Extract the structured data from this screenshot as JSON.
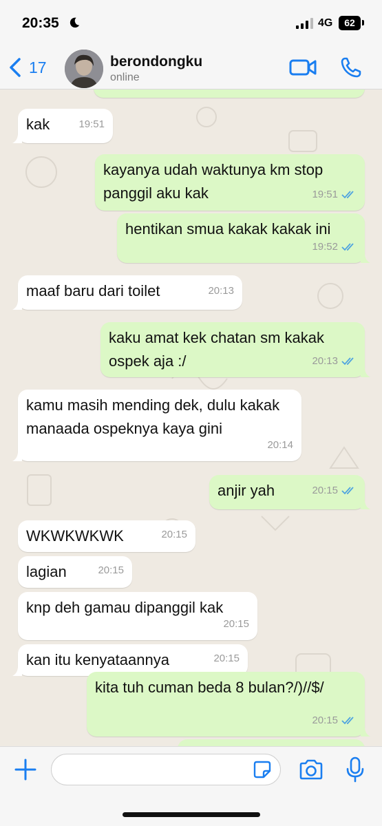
{
  "status_bar": {
    "time": "20:35",
    "network": "4G",
    "battery": "62"
  },
  "header": {
    "back_count": "17",
    "contact_name": "berondongku",
    "contact_status": "online"
  },
  "messages": [
    {
      "direction": "in",
      "text": "kak",
      "time": "19:51"
    },
    {
      "direction": "out",
      "text": "kayanya udah waktunya km stop panggil aku kak",
      "time": "19:51"
    },
    {
      "direction": "out",
      "text": "hentikan smua kakak kakak ini",
      "time": "19:52"
    },
    {
      "direction": "in",
      "text": "maaf baru dari toilet",
      "time": "20:13"
    },
    {
      "direction": "out",
      "text": "kaku amat kek chatan sm kakak ospek aja :/",
      "time": "20:13"
    },
    {
      "direction": "in",
      "text": "kamu masih mending dek, dulu kakak manaada ospeknya kaya gini",
      "time": "20:14"
    },
    {
      "direction": "out",
      "text": "anjir yah",
      "time": "20:15"
    },
    {
      "direction": "in",
      "text": "WKWKWKWK",
      "time": "20:15"
    },
    {
      "direction": "in",
      "text": "lagian",
      "time": "20:15"
    },
    {
      "direction": "in",
      "text": "knp deh gamau dipanggil kak",
      "time": "20:15"
    },
    {
      "direction": "in",
      "text": "kan itu kenyataannya",
      "time": "20:15"
    },
    {
      "direction": "out",
      "text": "kita tuh cuman beda 8 bulan?/)//$/",
      "time": "20:15"
    }
  ],
  "composer": {
    "placeholder": ""
  },
  "colors": {
    "accent": "#1a7ef0",
    "outgoing_bubble": "#dcf8c6",
    "incoming_bubble": "#ffffff",
    "read_ticks": "#4fa3e0"
  }
}
